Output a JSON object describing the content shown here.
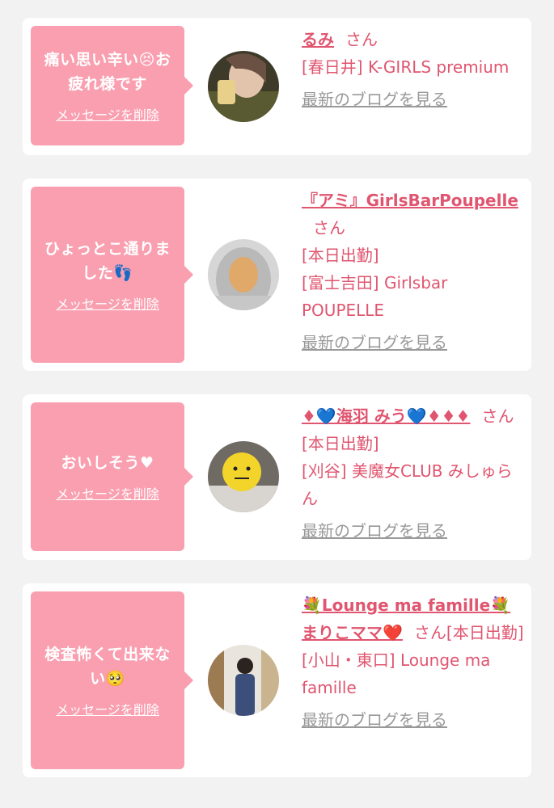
{
  "delete_label": "メッセージを削除",
  "blog_label": "最新のブログを見る",
  "san_label": "さん",
  "cards": [
    {
      "message": "痛い思い辛い😣お\n疲れ様です",
      "name": "るみ",
      "status": "",
      "shop": "[春日井] K-GIRLS premium"
    },
    {
      "message": "ひょっとこ通りま\nした👣",
      "name": "『アミ』GirlsBarPoupelle",
      "status": "[本日出勤]",
      "shop": "[富士吉田] Girlsbar POUPELLE"
    },
    {
      "message": "おいしそう♥",
      "name": "♦💙海羽 みう💙♦♦♦",
      "status": "[本日出勤]",
      "shop": "[刈谷] 美魔女CLUB みしゅらん"
    },
    {
      "message": "検査怖くて出来な\nい🥺",
      "name": "💐Lounge ma famille💐まりこママ❤️",
      "status": "[本日出勤]",
      "shop": "[小山・東口] Lounge ma famille"
    }
  ]
}
